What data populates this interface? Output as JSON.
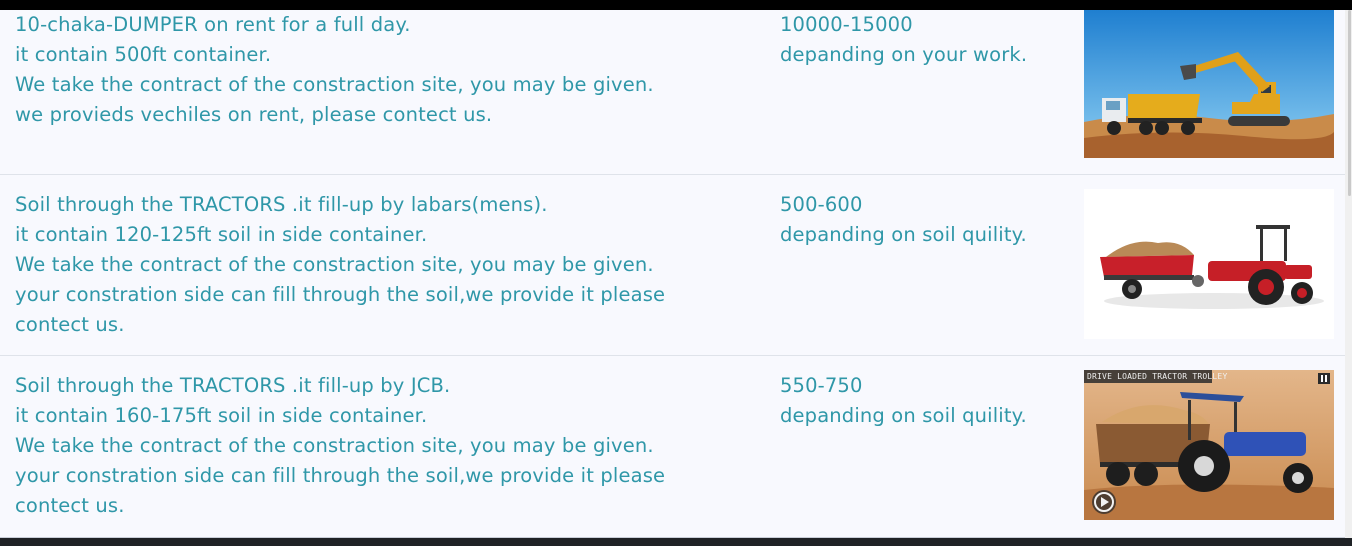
{
  "rows": [
    {
      "description_lines": [
        "10-chaka-DUMPER on rent for a full day.",
        "it contain 500ft container.",
        "We take the contract of the constraction site, you may be given.",
        "we provieds vechiles on rent, please contect us."
      ],
      "price_range": "10000-15000",
      "price_note": "depanding on your work.",
      "image_icon": "dumper-excavator-image"
    },
    {
      "description_lines": [
        "Soil through the TRACTORS .it fill-up by labars(mens).",
        "it contain 120-125ft soil in side container.",
        "We take the contract of the constraction site, you may be given.",
        "your constration side can fill through the soil,we provide it please",
        "contect us."
      ],
      "price_range": "500-600",
      "price_note": "depanding on soil quility.",
      "image_icon": "red-tractor-trolley-image"
    },
    {
      "description_lines": [
        "Soil through the TRACTORS .it fill-up by JCB.",
        "it contain 160-175ft soil in side container.",
        "We take the contract of the constraction site, you may be given.",
        "your constration side can fill through the soil,we provide it please",
        "contect us."
      ],
      "price_range": "550-750",
      "price_note": "depanding on soil quility.",
      "image_icon": "blue-tractor-trolley-image",
      "image_caption": "DRIVE LOADED TRACTOR TROLLEY"
    }
  ],
  "colors": {
    "text": "#2f97a8",
    "row_background": "#f8f9fe",
    "divider": "#dfe3ea"
  }
}
